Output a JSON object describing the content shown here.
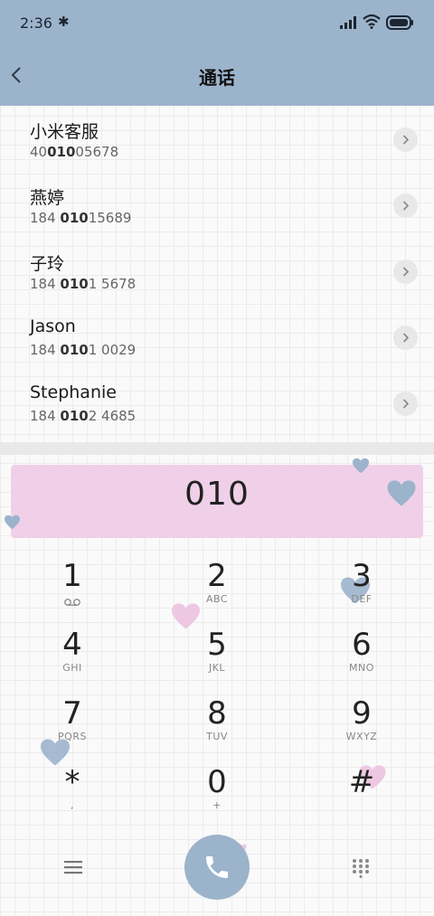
{
  "status": {
    "time": "2:36",
    "bluetooth": "✱"
  },
  "header": {
    "title": "通话"
  },
  "contacts": [
    {
      "name": "小米客服",
      "num_pre": "40",
      "num_match": "010",
      "num_post": "05678"
    },
    {
      "name": "燕婷",
      "num_pre": "184 ",
      "num_match": "010",
      "num_post": "15689"
    },
    {
      "name": "子玲",
      "num_pre": "184 ",
      "num_match": "010",
      "num_post": "1 5678"
    },
    {
      "name": "Jason",
      "num_pre": "184 ",
      "num_match": "010",
      "num_post": "1 0029"
    },
    {
      "name": "Stephanie",
      "num_pre": "184 ",
      "num_match": "010",
      "num_post": "2 4685"
    }
  ],
  "dialer": {
    "input": "010"
  },
  "keypad": [
    {
      "main": "1",
      "sub": ""
    },
    {
      "main": "2",
      "sub": "ABC"
    },
    {
      "main": "3",
      "sub": "DEF"
    },
    {
      "main": "4",
      "sub": "GHI"
    },
    {
      "main": "5",
      "sub": "JKL"
    },
    {
      "main": "6",
      "sub": "MNO"
    },
    {
      "main": "7",
      "sub": "PQRS"
    },
    {
      "main": "8",
      "sub": "TUV"
    },
    {
      "main": "9",
      "sub": "WXYZ"
    },
    {
      "main": "*",
      "sub": ","
    },
    {
      "main": "0",
      "sub": "+"
    },
    {
      "main": "#",
      "sub": ""
    }
  ],
  "icons": {
    "back": "chevron-left-icon",
    "contact_detail": "chevron-right-icon",
    "voicemail": "voicemail-icon",
    "menu": "menu-icon",
    "call": "phone-icon",
    "dialpad": "dialpad-icon"
  },
  "colors": {
    "accent": "#9cb3cc",
    "display": "#f0d0e8",
    "heart_blue": "#9cb3cc",
    "heart_pink": "#eec8e2"
  }
}
